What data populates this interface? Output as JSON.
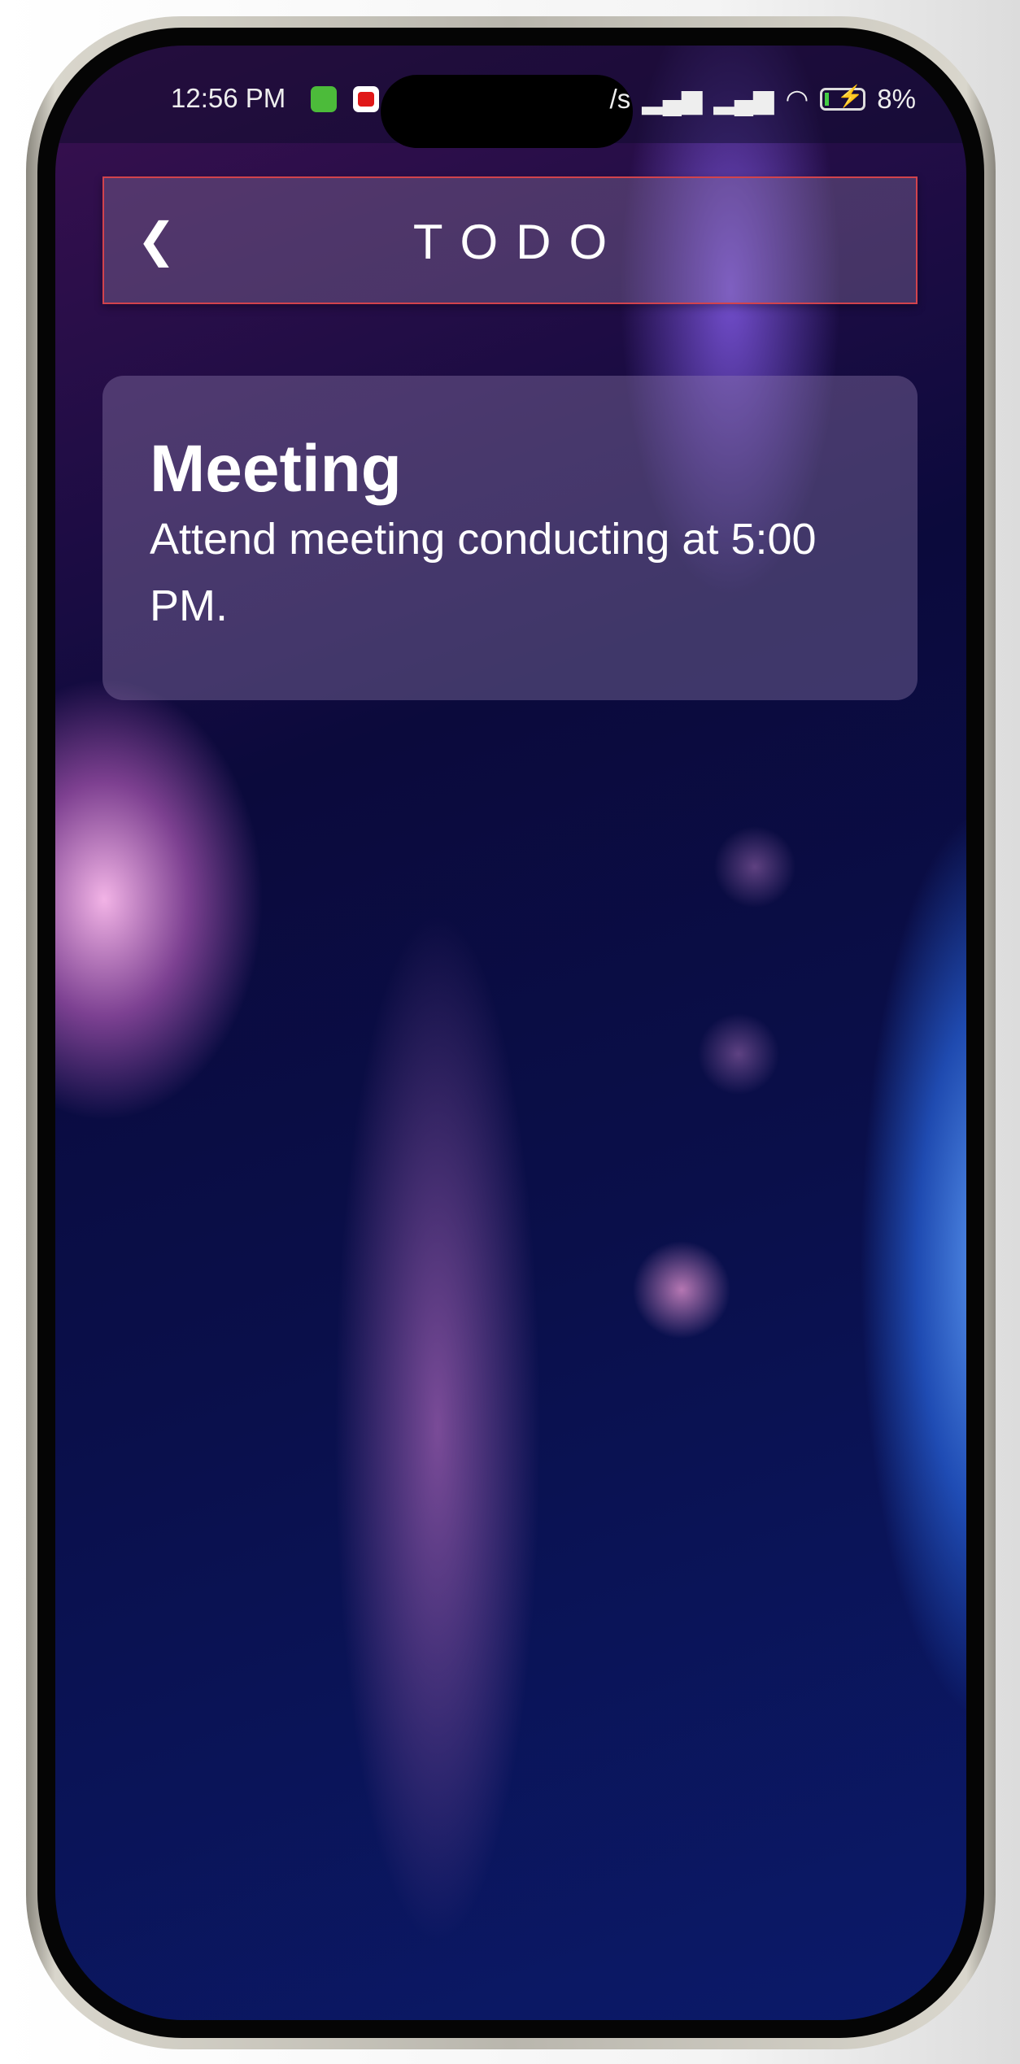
{
  "status_bar": {
    "time": "12:56 PM",
    "speed_fragment": "/s",
    "battery": "8%"
  },
  "header": {
    "title": "TODO",
    "back_icon": "chevron-left-icon"
  },
  "todo": {
    "title": "Meeting",
    "description": "Attend meeting conducting at 5:00 PM."
  }
}
